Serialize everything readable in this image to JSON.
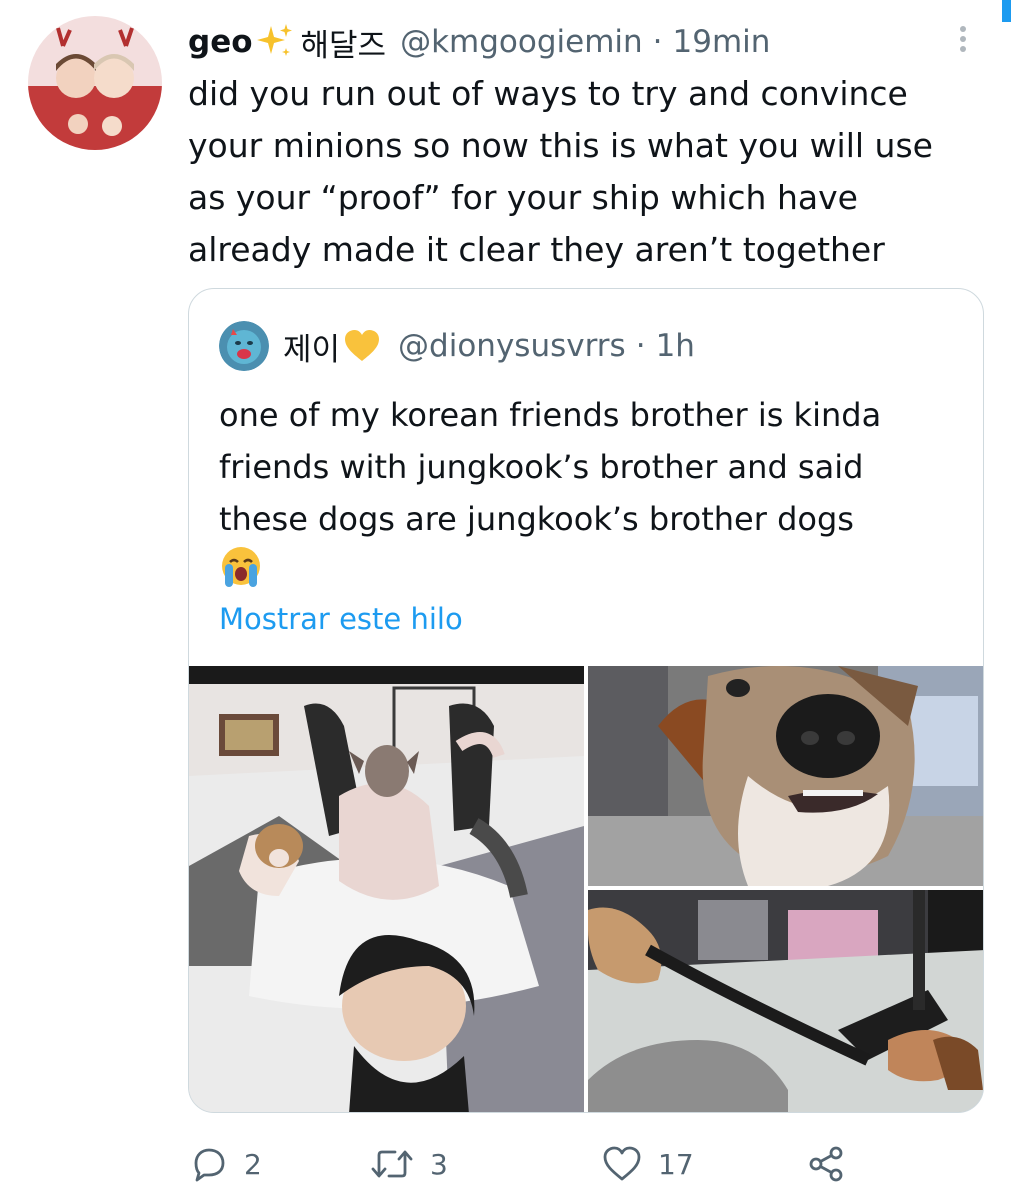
{
  "tweet": {
    "author": {
      "name": "geo",
      "name_emoji": "sparkles-icon",
      "name_korean": "해달즈",
      "handle": "@kmgoogiemin",
      "separator": "·",
      "time": "19min"
    },
    "text_lines": [
      "did you run out of ways to try and convince",
      "your minions so now this is what you will use",
      "as your “proof” for your ship which have",
      "already made it clear they aren’t together"
    ],
    "quoted": {
      "name": "제이",
      "name_emoji": "yellow-heart-icon",
      "handle": "@dionysusvrrs",
      "separator": "·",
      "time": "1h",
      "text_lines": [
        "one of my korean friends brother is kinda",
        "friends with jungkook’s brother and said",
        "these dogs are jungkook’s brother dogs"
      ],
      "trailing_emoji": "loudly-crying-face-icon",
      "show_thread": "Mostrar este hilo",
      "photos": [
        "photo-person-with-dogs",
        "photo-dog-closeup",
        "photo-dog-playing"
      ]
    },
    "actions": {
      "reply_count": "2",
      "retweet_count": "3",
      "like_count": "17"
    },
    "colors": {
      "text": "#0f1419",
      "secondary": "#536471",
      "link": "#1d9bf0",
      "border": "#cfd9de"
    }
  }
}
